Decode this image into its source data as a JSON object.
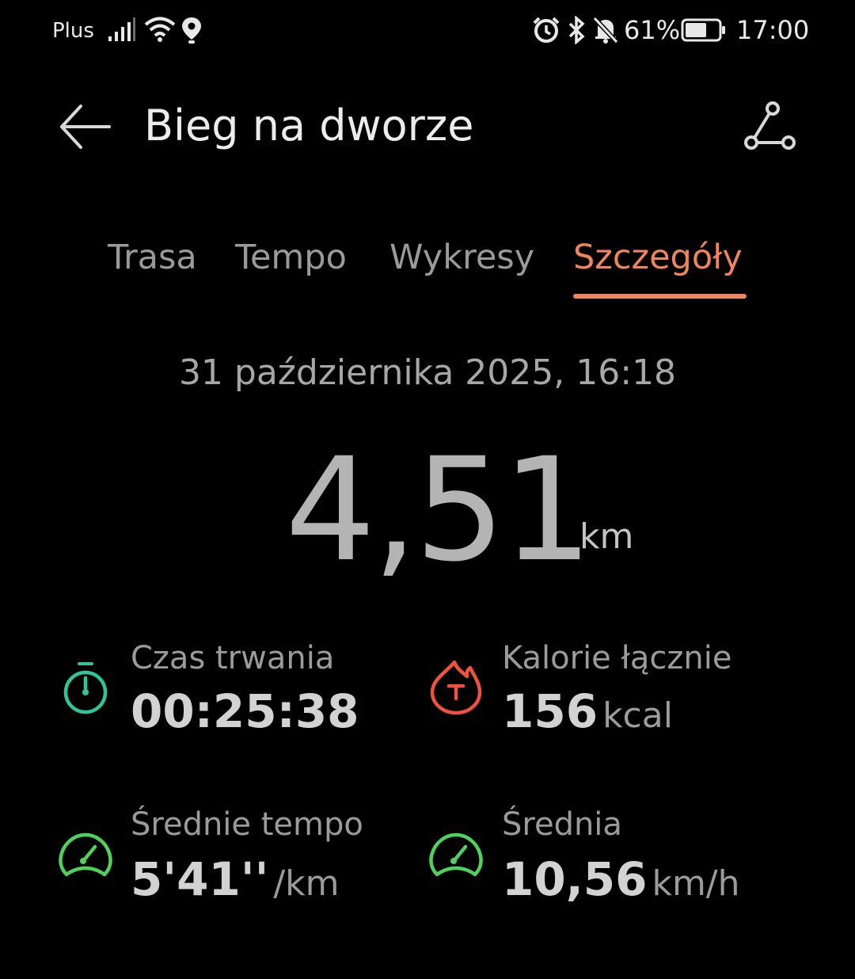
{
  "status_bar": {
    "carrier": "Plus",
    "battery": "61%",
    "time": "17:00",
    "icons": [
      "signal-icon",
      "wifi-icon",
      "location-icon",
      "alarm-icon",
      "bluetooth-icon",
      "mute-icon",
      "battery-icon"
    ]
  },
  "header": {
    "title": "Bieg na dworze",
    "back_icon": "arrow-left-icon",
    "share_icon": "route-share-icon"
  },
  "tabs": [
    {
      "label": "Trasa",
      "active": false
    },
    {
      "label": "Tempo",
      "active": false
    },
    {
      "label": "Wykresy",
      "active": false
    },
    {
      "label": "Szczegóły",
      "active": true
    }
  ],
  "workout": {
    "date": "31 października 2025, 16:18",
    "distance": "4,51",
    "distance_unit": "km"
  },
  "stats": [
    {
      "label": "Czas trwania",
      "value": "00:25:38",
      "unit": "",
      "icon": "stopwatch-icon",
      "color": "#2fc59a"
    },
    {
      "label": "Kalorie łącznie",
      "value": "156",
      "unit": "kcal",
      "icon": "flame-icon",
      "color": "#f0533c"
    },
    {
      "label": "Średnie tempo",
      "value": "5'41''",
      "unit": "/km",
      "icon": "speedometer-icon",
      "color": "#4fd25c"
    },
    {
      "label": "Średnia",
      "value": "10,56",
      "unit": "km/h",
      "icon": "speedometer-icon",
      "color": "#4fd25c"
    }
  ],
  "colors": {
    "accent": "#f0845a",
    "background": "#000000"
  }
}
